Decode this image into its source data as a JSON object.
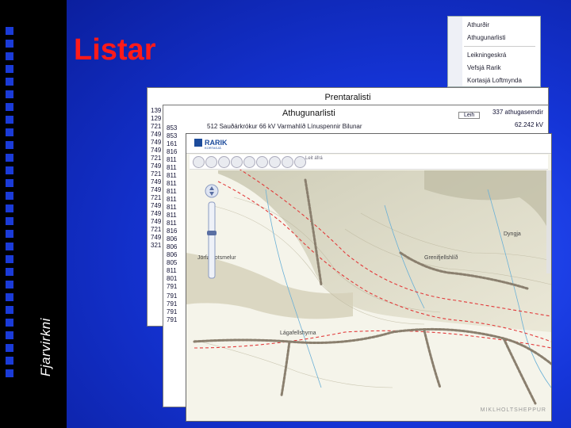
{
  "slide": {
    "title": "Listar",
    "side_label": "Fjarvirkni",
    "colors": {
      "title": "#ff1a1a",
      "background": "#1535d8",
      "left_bar": "#000000"
    }
  },
  "context_menu": {
    "items": [
      "Athurðir",
      "Athugunarlisti",
      "Leikningeskrá",
      "Vefsjá Rarik",
      "Kortasjá Loftmynda"
    ]
  },
  "print_list": {
    "title": "Prentaralisti",
    "codes": [
      "139",
      "129",
      "721",
      "749",
      "749",
      "749",
      "721",
      "749",
      "721",
      "749",
      "749",
      "721",
      "749",
      "749",
      "749",
      "721",
      "749",
      "321"
    ]
  },
  "watch_list": {
    "title": "Athugunarlisti",
    "header_button": "Leih",
    "count_label": "337 athugasemdir",
    "power_value": "62.242 kV",
    "first_row": "512 Sauðárkrókur  66 kV  Varmahlíð  Línuspennir Bilunar",
    "codes": [
      "853",
      "853",
      "161",
      "816",
      "811",
      "811",
      "811",
      "811",
      "811",
      "811",
      "811",
      "811",
      "811",
      "816",
      "806",
      "806",
      "806",
      "805",
      "811",
      "801",
      "791"
    ],
    "codes_lower": [
      "791",
      "791",
      "791",
      "791"
    ]
  },
  "map_window": {
    "logo_text": "RARIK",
    "logo_sub": "KORTASJÁ",
    "search_placeholder": "Leit áfrá",
    "labels": [
      "Jörfabrotsmelur",
      "Lágafellshyrna",
      "Grenifjellshlíð",
      "Dyngja"
    ],
    "credit": "MIKLHOLTSHEPPUR",
    "icons": [
      "zoom-in-icon",
      "zoom-out-icon",
      "hand-pan-icon",
      "globe-icon",
      "ruler-icon",
      "layers-icon",
      "print-icon",
      "home-icon",
      "search-icon"
    ],
    "colors": {
      "terrain": "#f5f4ea",
      "lines": "#e23a3a",
      "towers": "#8a7f6e"
    }
  }
}
